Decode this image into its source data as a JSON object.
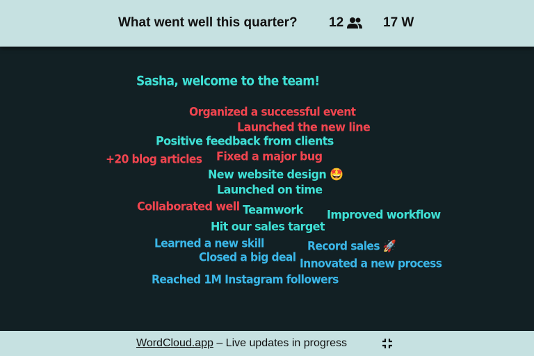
{
  "header": {
    "title": "What went well this quarter?",
    "participants": "12",
    "participants_icon": "users-icon",
    "word_count": "17 W"
  },
  "colors": {
    "cyan": "#3fe0d5",
    "red": "#f1454f",
    "blue": "#3bb7e8"
  },
  "cloud": {
    "words": [
      {
        "text": "Sasha, welcome to the team!",
        "color": "cyan"
      },
      {
        "text": "Organized a successful event",
        "color": "red"
      },
      {
        "text": "Launched the new line",
        "color": "red"
      },
      {
        "text": "Positive feedback from clients",
        "color": "cyan"
      },
      {
        "text": "+20 blog articles",
        "color": "red"
      },
      {
        "text": "Fixed a major bug",
        "color": "red"
      },
      {
        "text": "New website design 🤩",
        "color": "cyan"
      },
      {
        "text": "Launched on time",
        "color": "cyan"
      },
      {
        "text": "Collaborated well",
        "color": "red"
      },
      {
        "text": "Teamwork",
        "color": "cyan"
      },
      {
        "text": "Improved workflow",
        "color": "cyan"
      },
      {
        "text": "Hit our sales target",
        "color": "cyan"
      },
      {
        "text": "Learned a new skill",
        "color": "blue"
      },
      {
        "text": "Record sales 🚀",
        "color": "blue"
      },
      {
        "text": "Closed a big deal",
        "color": "blue"
      },
      {
        "text": "Innovated a new process",
        "color": "blue"
      },
      {
        "text": "Reached 1M Instagram followers",
        "color": "blue"
      }
    ]
  },
  "footer": {
    "link": "WordCloud.app",
    "status": " – Live updates in progress",
    "collapse_icon": "collapse-icon"
  }
}
